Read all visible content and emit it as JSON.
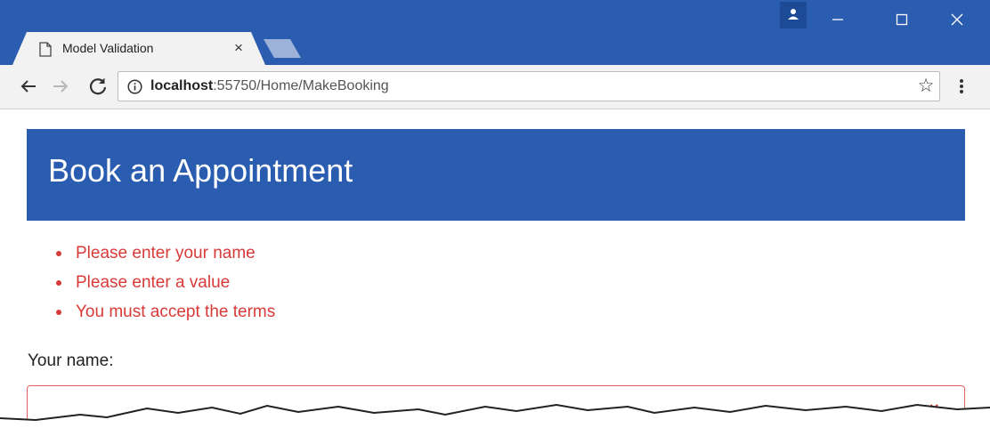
{
  "browser": {
    "tab": {
      "title": "Model Validation",
      "close_glyph": "×"
    },
    "window_controls": {
      "minimize": "–",
      "maximize": "☐",
      "close": "✕"
    },
    "address": {
      "host": "localhost",
      "rest": ":55750/Home/MakeBooking"
    },
    "icons": [
      "document-icon",
      "back-arrow-icon",
      "forward-arrow-icon",
      "reload-icon",
      "info-icon",
      "star-icon",
      "menu-dots-icon",
      "profile-icon"
    ],
    "colors": {
      "chrome_accent": "#2a5db0",
      "toolbar": "#f2f2f2"
    }
  },
  "page": {
    "title": "Book an Appointment",
    "errors": [
      "Please enter your name",
      "Please enter a value",
      "You must accept the terms"
    ],
    "name_label": "Your name:",
    "name_value": "",
    "error_icon": "×",
    "colors": {
      "header_bg": "#2a5db0",
      "error": "#d83a38"
    }
  }
}
